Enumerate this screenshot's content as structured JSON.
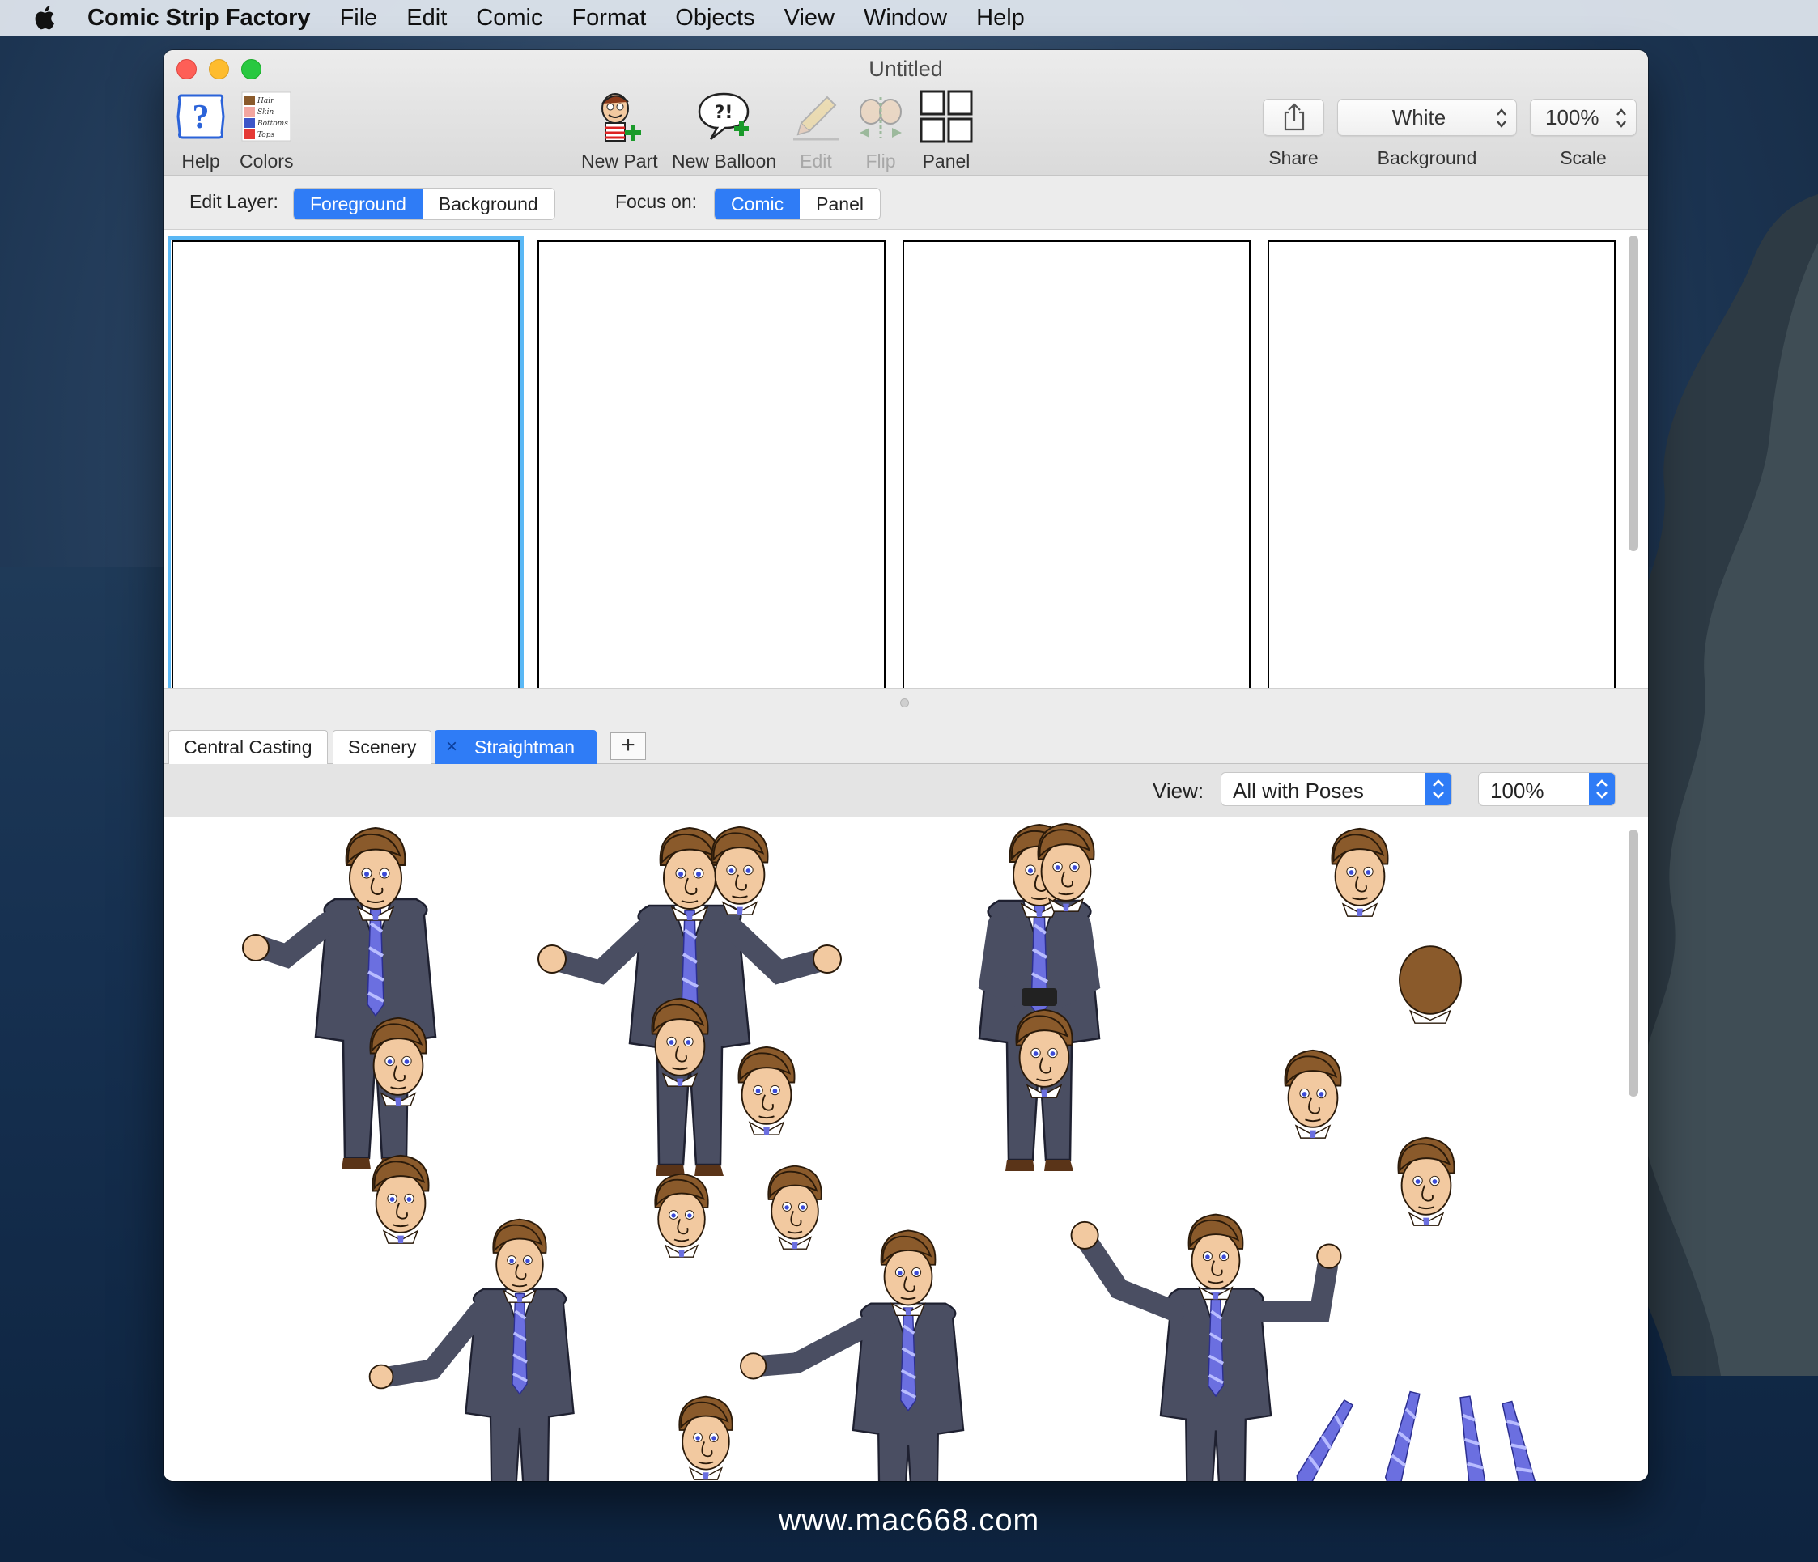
{
  "menubar": {
    "app_name": "Comic Strip Factory",
    "items": [
      "File",
      "Edit",
      "Comic",
      "Format",
      "Objects",
      "View",
      "Window",
      "Help"
    ]
  },
  "window": {
    "title": "Untitled"
  },
  "toolbar": {
    "help": "Help",
    "colors": "Colors",
    "new_part": "New Part",
    "new_balloon": "New Balloon",
    "edit": "Edit",
    "flip": "Flip",
    "panel": "Panel",
    "share": "Share",
    "background_label": "Background",
    "background_value": "White",
    "scale_label": "Scale",
    "scale_value": "100%",
    "colors_swatch_text": [
      "Hair",
      "Skin",
      "Bottoms",
      "Tops"
    ]
  },
  "layerbar": {
    "edit_layer_label": "Edit Layer:",
    "edit_layer_options": [
      "Foreground",
      "Background"
    ],
    "edit_layer_selected": "Foreground",
    "focus_label": "Focus on:",
    "focus_options": [
      "Comic",
      "Panel"
    ],
    "focus_selected": "Comic"
  },
  "comic": {
    "panel_count": 4,
    "selected_panel": 1
  },
  "library": {
    "tabs": [
      "Central Casting",
      "Scenery",
      "Straightman"
    ],
    "active_tab": "Straightman",
    "add_tab_symbol": "+",
    "view_label": "View:",
    "view_value": "All with Poses",
    "zoom_value": "100%"
  },
  "watermark": "www.mac668.com",
  "colors": {
    "accent": "#2f7cf6",
    "suit": "#4a4e62",
    "hair": "#8a5a2b",
    "skin": "#f2c9a0",
    "tie": "#6b6fe0"
  }
}
